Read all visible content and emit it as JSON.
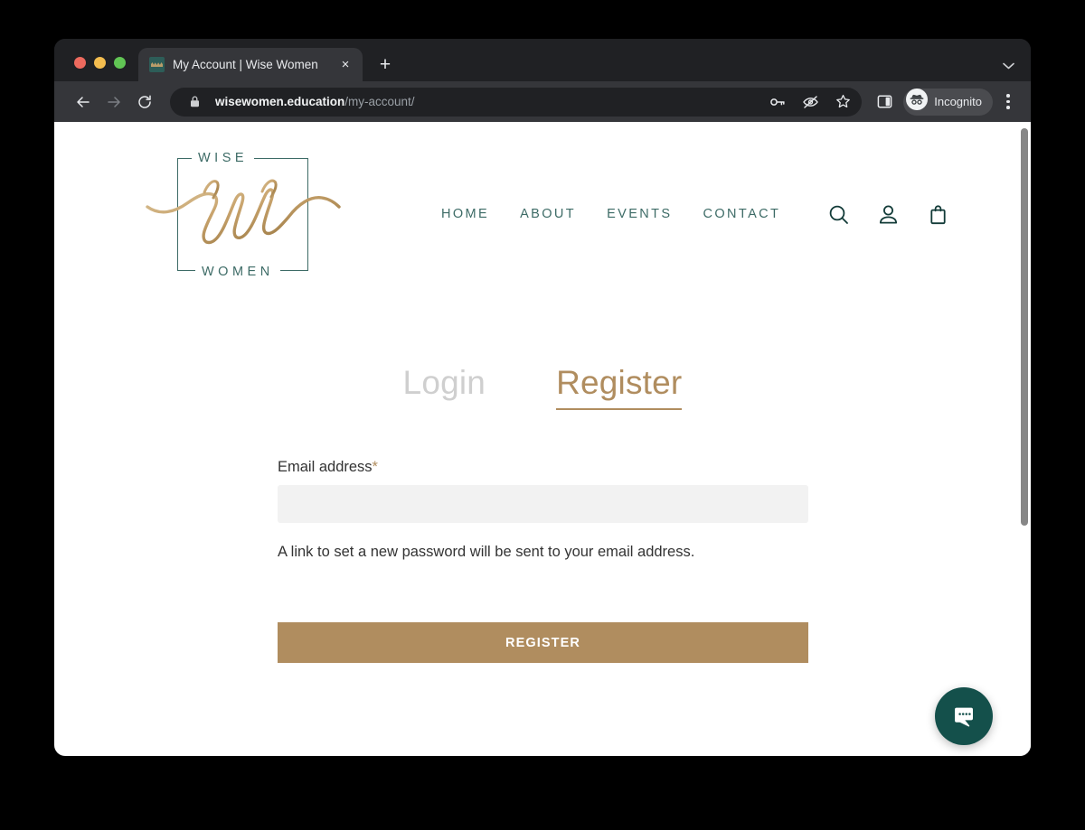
{
  "browser": {
    "window_controls": [
      "close",
      "minimize",
      "maximize"
    ],
    "tab": {
      "title": "My Account | Wise Women",
      "favicon_name": "wise-women-favicon",
      "close_label": "×"
    },
    "new_tab_label": "+",
    "tab_list_chevron": "⌄",
    "toolbar": {
      "back_label": "back-arrow",
      "forward_label": "forward-arrow",
      "reload_label": "reload",
      "lock_label": "site-secure-lock",
      "url_domain": "wisewomen.education",
      "url_path": "/my-account/",
      "password_manager_label": "password-key",
      "tracking_protection_label": "eye-crossed",
      "bookmark_label": "star",
      "side_panel_label": "side-panel",
      "incognito_label": "Incognito",
      "menu_label": "chrome-menu"
    }
  },
  "site": {
    "logo": {
      "top_word": "WISE",
      "bottom_word": "WOMEN",
      "monogram": "ww",
      "frame_color": "#3d6b66",
      "monogram_color": "#c9a46d"
    },
    "nav": [
      {
        "label": "HOME"
      },
      {
        "label": "ABOUT"
      },
      {
        "label": "EVENTS"
      },
      {
        "label": "CONTACT"
      }
    ],
    "nav_color": "#3d6b66",
    "header_icons": [
      {
        "name": "search-icon"
      },
      {
        "name": "account-icon"
      },
      {
        "name": "cart-bag-icon"
      }
    ]
  },
  "account": {
    "tabs": {
      "login": "Login",
      "register": "Register",
      "active": "Register",
      "inactive_color": "#cfcfcf",
      "active_color": "#b08d5f"
    },
    "form": {
      "email_label": "Email address",
      "required_marker": "*",
      "email_value": "",
      "email_placeholder": "",
      "hint": "A link to set a new password will be sent to your email address.",
      "submit_label": "REGISTER",
      "submit_color": "#b08d5f",
      "input_background": "#f2f2f2"
    }
  },
  "chat": {
    "widget_name": "chat-bubble-button",
    "color": "#14504b"
  }
}
